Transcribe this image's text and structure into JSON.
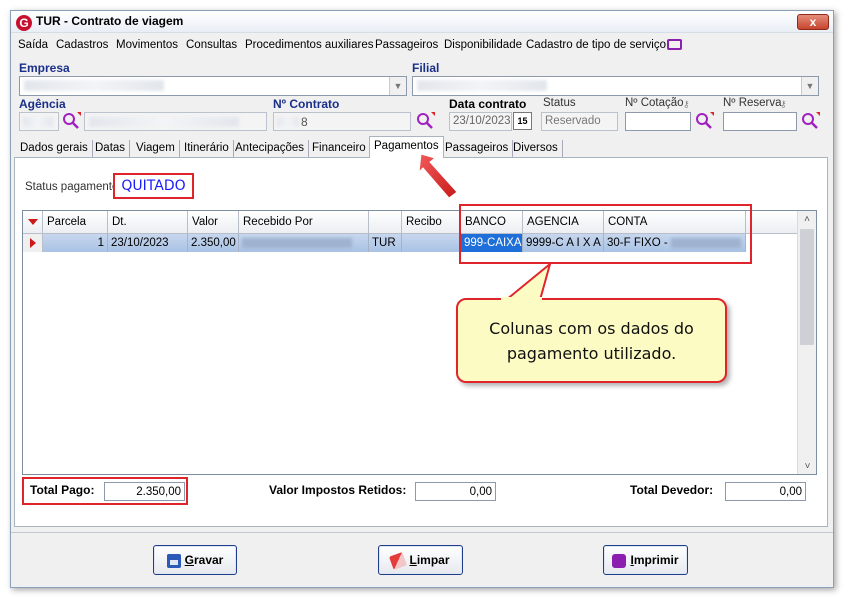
{
  "window": {
    "title": "TUR - Contrato de viagem",
    "close_label": "x"
  },
  "menu": [
    "Saída",
    "Cadastros",
    "Movimentos",
    "Consultas",
    "Procedimentos auxiliares",
    "Passageiros",
    "Disponibilidade",
    "Cadastro de tipo de serviço"
  ],
  "header": {
    "empresa_label": "Empresa",
    "filial_label": "Filial",
    "agencia_label": "Agência",
    "contrato_label": "Nº Contrato",
    "contrato_value": "8",
    "data_contrato_label": "Data contrato",
    "data_contrato_value": "23/10/2023",
    "calendar_label": "15",
    "status_label": "Status",
    "status_value": "Reservado",
    "cotacao_label": "Nº Cotação",
    "reserva_label": "Nº Reserva"
  },
  "tabs": [
    "Dados gerais",
    "Datas",
    "Viagem",
    "Itinerário",
    "Antecipações",
    "Financeiro",
    "Pagamentos",
    "Passageiros",
    "Diversos"
  ],
  "active_tab": "Pagamentos",
  "status_pagamento": {
    "label": "Status pagamento:",
    "value": "QUITADO"
  },
  "table": {
    "columns": [
      "Parcela",
      "Dt. pagamento",
      "Valor",
      "Recebido Por",
      "",
      "Recibo",
      "BANCO",
      "AGENCIA",
      "CONTA"
    ],
    "rows": [
      {
        "parcela": "1",
        "dt_pagamento": "23/10/2023",
        "valor": "2.350,00",
        "recebido_por": "",
        "tipo": "TUR",
        "recibo": "",
        "banco": "999-CAIXA",
        "agencia": "9999-C A I X A",
        "conta": "30-F FIXO -"
      }
    ]
  },
  "callout": {
    "line1": "Colunas com os dados do",
    "line2": "pagamento utilizado."
  },
  "totals": {
    "total_pago_label": "Total Pago:",
    "total_pago_value": "2.350,00",
    "impostos_label": "Valor Impostos Retidos:",
    "impostos_value": "0,00",
    "devedor_label": "Total Devedor:",
    "devedor_value": "0,00"
  },
  "buttons": {
    "gravar": "Gravar",
    "limpar": "Limpar",
    "imprimir": "Imprimir"
  },
  "colors": {
    "highlight": "#e0242b",
    "label_blue": "#1a2f8a",
    "quitado": "#1a1aff",
    "selected_cell": "#1e6fd9",
    "row_selected": "#b6cbe9",
    "callout_bg": "#fcfbc3"
  }
}
